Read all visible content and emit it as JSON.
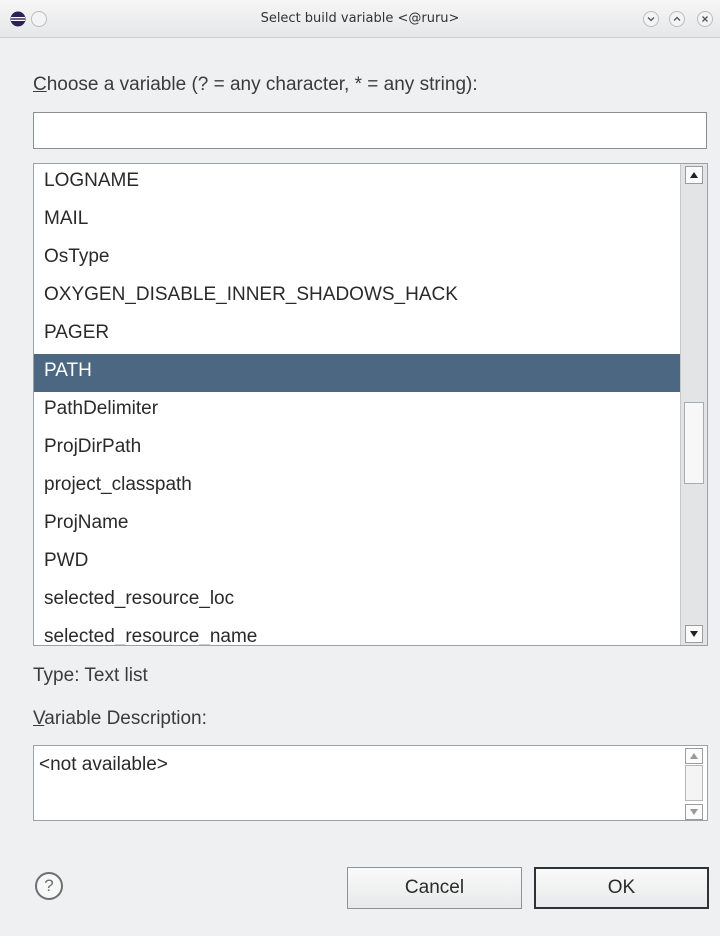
{
  "window": {
    "title": "Select build variable  <@ruru>"
  },
  "filter": {
    "label_accel": "C",
    "label_rest": "hoose a variable (? = any character, * = any string):",
    "value": ""
  },
  "variables": {
    "items": [
      "LOGNAME",
      "MAIL",
      "OsType",
      "OXYGEN_DISABLE_INNER_SHADOWS_HACK",
      "PAGER",
      "PATH",
      "PathDelimiter",
      "ProjDirPath",
      "project_classpath",
      "ProjName",
      "PWD",
      "selected_resource_loc",
      "selected_resource_name"
    ],
    "selected": "PATH"
  },
  "type_text": "Type: Text list",
  "description": {
    "label_accel": "V",
    "label_rest": "ariable Description:",
    "value": "<not available>"
  },
  "buttons": {
    "cancel": "Cancel",
    "ok": "OK",
    "help": "?"
  },
  "colors": {
    "selection": "#4b6782",
    "background": "#eff0f1"
  }
}
